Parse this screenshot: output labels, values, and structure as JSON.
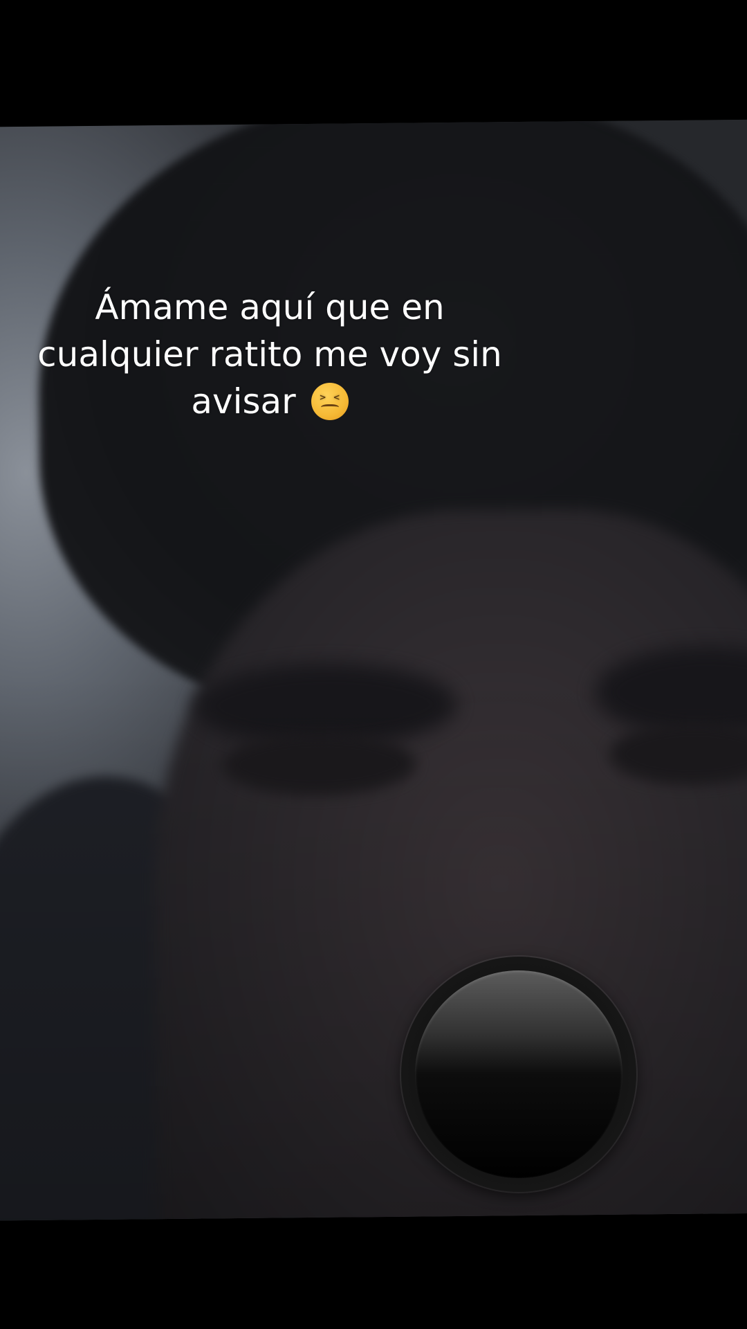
{
  "caption": {
    "lines": "Ámame aquí que en\ncualquier ratito me voy sin\navisar",
    "emoji": "confounded-face-emoji"
  },
  "record_button": {
    "icon": "record-button-icon"
  },
  "colors": {
    "background": "#000000",
    "caption_text": "#ffffff"
  }
}
